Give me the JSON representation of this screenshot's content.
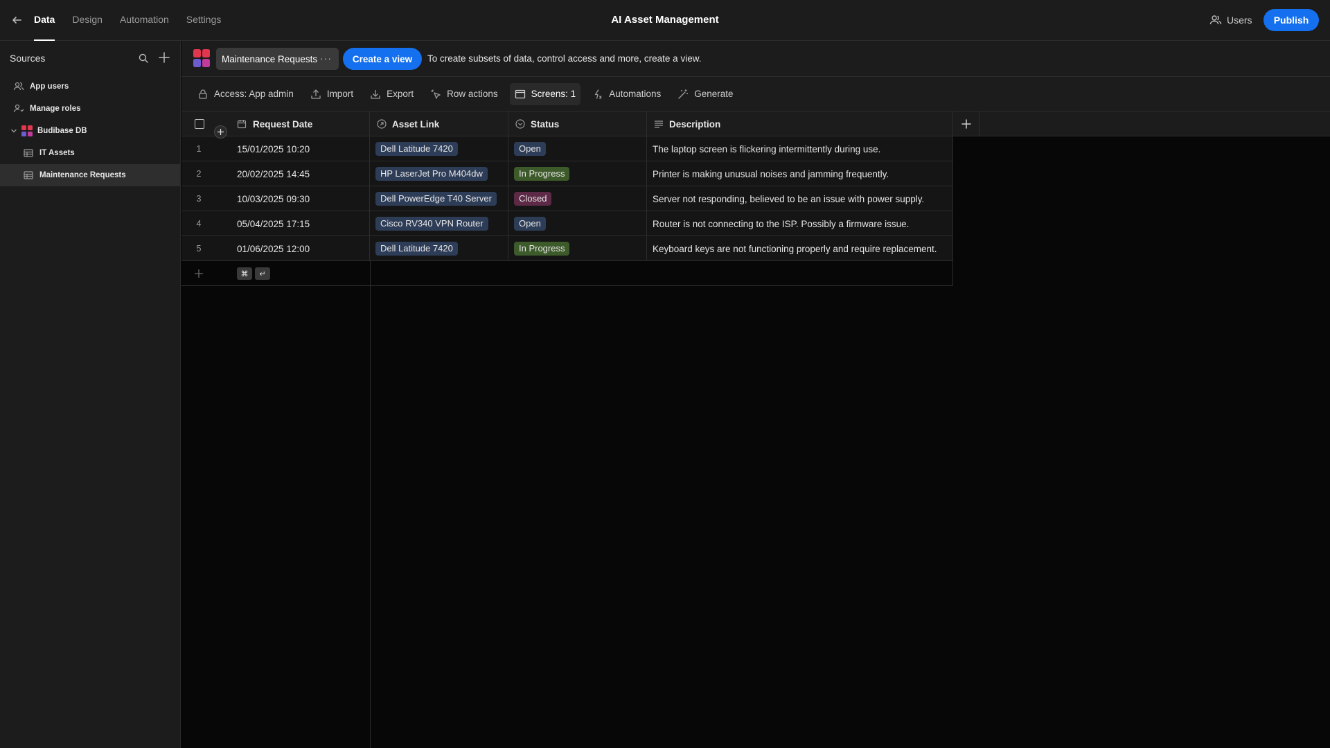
{
  "top_nav": {
    "tabs": [
      {
        "label": "Data",
        "active": true
      },
      {
        "label": "Design",
        "active": false
      },
      {
        "label": "Automation",
        "active": false
      },
      {
        "label": "Settings",
        "active": false
      }
    ],
    "app_title": "AI Asset Management",
    "users_label": "Users",
    "publish_label": "Publish"
  },
  "sidebar": {
    "title": "Sources",
    "items": [
      {
        "label": "App users",
        "icon": "users-icon"
      },
      {
        "label": "Manage roles",
        "icon": "user-roles-icon"
      },
      {
        "label": "Budibase DB",
        "icon": "budibase-logo",
        "expanded": true
      },
      {
        "label": "IT Assets",
        "icon": "table-icon"
      },
      {
        "label": "Maintenance Requests",
        "icon": "table-icon",
        "selected": true
      }
    ]
  },
  "header": {
    "table_name": "Maintenance Requests",
    "more_label": "···",
    "create_view_label": "Create a view",
    "hint": "To create subsets of data, control access and more, create a view."
  },
  "toolbar": {
    "access_label": "Access: App admin",
    "import_label": "Import",
    "export_label": "Export",
    "row_actions_label": "Row actions",
    "screens_label": "Screens: 1",
    "automations_label": "Automations",
    "generate_label": "Generate"
  },
  "grid": {
    "columns": [
      {
        "label": "Request Date",
        "icon": "calendar-icon"
      },
      {
        "label": "Asset Link",
        "icon": "link-icon"
      },
      {
        "label": "Status",
        "icon": "options-icon"
      },
      {
        "label": "Description",
        "icon": "text-icon"
      }
    ],
    "rows": [
      {
        "num": "1",
        "date": "15/01/2025 10:20",
        "asset": "Dell Latitude 7420",
        "status": "Open",
        "status_color": "#2e3d57",
        "description": "The laptop screen is flickering intermittently during use."
      },
      {
        "num": "2",
        "date": "20/02/2025 14:45",
        "asset": "HP LaserJet Pro M404dw",
        "status": "In Progress",
        "status_color": "#3d5a2b",
        "description": "Printer is making unusual noises and jamming frequently."
      },
      {
        "num": "3",
        "date": "10/03/2025 09:30",
        "asset": "Dell PowerEdge T40 Server",
        "status": "Closed",
        "status_color": "#5c2a47",
        "description": "Server not responding, believed to be an issue with power supply."
      },
      {
        "num": "4",
        "date": "05/04/2025 17:15",
        "asset": "Cisco RV340 VPN Router",
        "status": "Open",
        "status_color": "#2e3d57",
        "description": "Router is not connecting to the ISP. Possibly a firmware issue."
      },
      {
        "num": "5",
        "date": "01/06/2025 12:00",
        "asset": "Dell Latitude 7420",
        "status": "In Progress",
        "status_color": "#3d5a2b",
        "description": "Keyboard keys are not functioning properly and require replacement."
      }
    ],
    "shortcut_keys": [
      "⌘",
      "↵"
    ]
  },
  "colors": {
    "accent": "#1570ef",
    "background": "#070707",
    "panel": "#1c1c1c"
  }
}
